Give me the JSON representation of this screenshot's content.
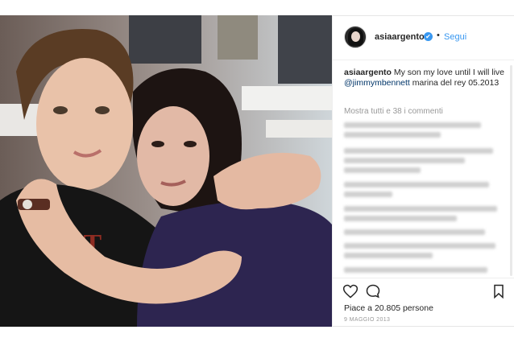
{
  "post": {
    "username": "asiaargento",
    "follow_label": "Segui",
    "separator": "•",
    "verified_icon": "✔",
    "caption_username": "asiaargento",
    "caption_text_1": " My son my love until I will live ",
    "caption_mention": "@jimmymbennett",
    "caption_text_2": " marina del rey 05.2013",
    "view_all_comments": "Mostra tutti e 38 i commenti",
    "likes": "Piace a 20.805 persone",
    "date": "9 MAGGIO 2013"
  },
  "icons": {
    "avatar": "avatar-image",
    "verified": "verified-badge-icon",
    "like": "heart-icon",
    "comment": "comment-bubble-icon",
    "save": "bookmark-icon"
  },
  "colors": {
    "link_blue": "#3897f0",
    "verified_blue": "#3897f0",
    "text": "#262626",
    "muted": "#999999"
  }
}
